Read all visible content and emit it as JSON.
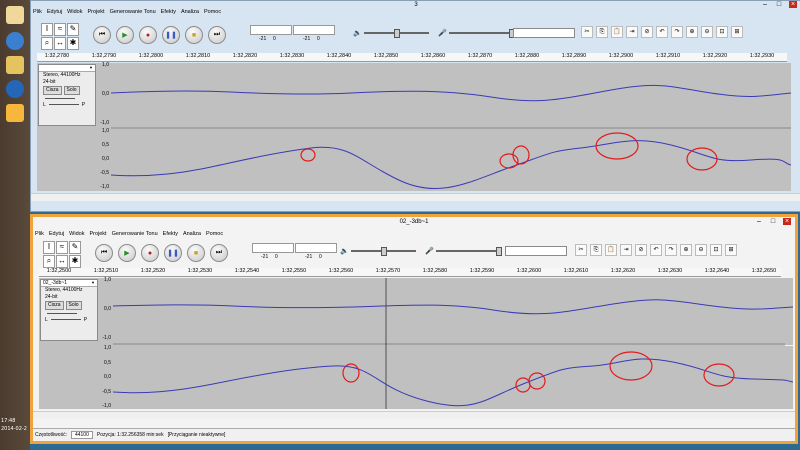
{
  "taskbar": {
    "clock_time": "17:48",
    "clock_date": "2014-02-2"
  },
  "top_window": {
    "title": "3",
    "menu": [
      "Plik",
      "Edytuj",
      "Widok",
      "Projekt",
      "Generowanie Tonu",
      "Efekty",
      "Analiza",
      "Pomoc"
    ],
    "meter_left": "-21",
    "meter_right": "-21",
    "meter_zero": "0",
    "ruler_ticks": [
      "1:32,2780",
      "1:32,2790",
      "1:32,2800",
      "1:32,2810",
      "1:32,2820",
      "1:32,2830",
      "1:32,2840",
      "1:32,2850",
      "1:32,2860",
      "1:32,2870",
      "1:32,2880",
      "1:32,2890",
      "1:32,2900",
      "1:32,2910",
      "1:32,2920",
      "1:32,2930"
    ],
    "track": {
      "format": "Stereo, 44100Hz",
      "bits": "24-bit",
      "mute": "Cisza",
      "solo": "Solo",
      "pan_l": "L",
      "pan_r": "P",
      "scale": [
        "1,0",
        "0,5",
        "0,0",
        "-0,5",
        "-1,0"
      ]
    }
  },
  "bottom_window": {
    "title": "02_-3db~1",
    "menu": [
      "Plik",
      "Edytuj",
      "Widok",
      "Projekt",
      "Generowanie Tonu",
      "Efekty",
      "Analiza",
      "Pomoc"
    ],
    "meter_left": "-21",
    "meter_right": "-21",
    "meter_zero": "0",
    "ruler_ticks": [
      "1:32,2500",
      "1:32,2510",
      "1:32,2520",
      "1:32,2530",
      "1:32,2540",
      "1:32,2550",
      "1:32,2560",
      "1:32,2570",
      "1:32,2580",
      "1:32,2590",
      "1:32,2600",
      "1:32,2610",
      "1:32,2620",
      "1:32,2630",
      "1:32,2640",
      "1:32,2650"
    ],
    "track": {
      "name": "02_-3db~1",
      "format": "Stereo, 44100Hz",
      "bits": "24-bit",
      "mute": "Cisza",
      "solo": "Solo",
      "pan_l": "L",
      "pan_r": "P",
      "scale": [
        "1,0",
        "0,5",
        "0,0",
        "-0,5",
        "-1,0"
      ]
    },
    "status": {
      "rate_label": "Częstotliwość:",
      "rate_value": "44100",
      "position": "Pozycja: 1:32.256358 min:sek",
      "snap": "[Przyciąganie nieaktywne]"
    }
  },
  "colors": {
    "waveform": "#3a3ab5",
    "annotation": "#e31b1b",
    "highlight_border": "#f0a33c"
  }
}
